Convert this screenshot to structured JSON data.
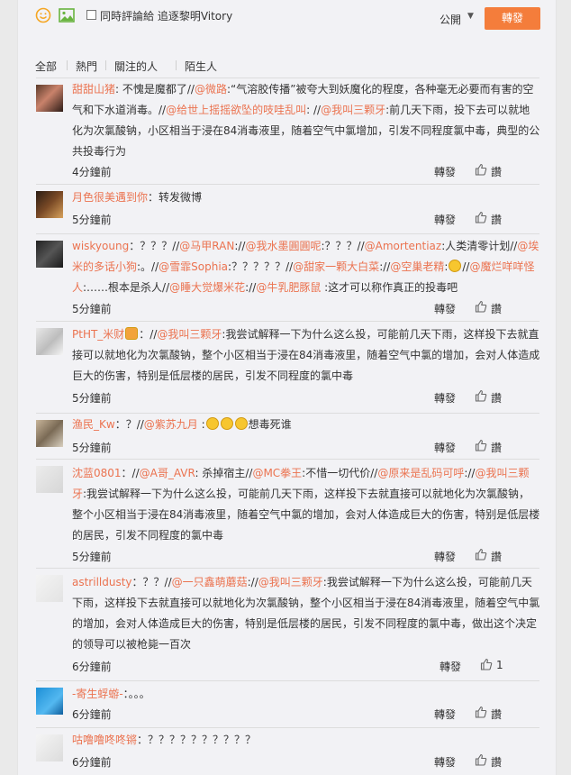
{
  "toolbar": {
    "emoji_icon": "smile-icon",
    "image_icon": "image-icon",
    "checkbox_label": "同時評論給 追逐黎明Vitory",
    "visibility": "公開",
    "forward_button": "轉發"
  },
  "tabs": [
    "全部",
    "熱門",
    "關注的人",
    "陌生人"
  ],
  "actions": {
    "forward": "轉發",
    "like": "讚"
  },
  "comments": [
    {
      "user": "甜甜山猪",
      "segments": [
        ": 不愧是魔都了//",
        "@微路",
        ":“气溶胶传播”被夸大到妖魔化的程度，各种毫无必要而有害的空气和下水道消毒。//",
        "@给世上摇摇欲坠的吱哇乱叫",
        ": //",
        "@我叫三颗牙",
        ":前几天下雨，投下去可以就地化为次氯酸钠，小区相当于浸在84消毒液里，随着空气中氯增加，引发不同程度氯中毒，典型的公共投毒行为"
      ],
      "time": "4分鐘前",
      "likes": ""
    },
    {
      "user": "月色很美遇到你",
      "segments": [
        "：转发微博"
      ],
      "time": "5分鐘前",
      "likes": ""
    },
    {
      "user": "wiskyoung",
      "segments": [
        "：？？？//",
        "@马甲RAN",
        "://",
        "@我水墨圓圓呢",
        ":？？？//",
        "@Amortentiaz",
        ":人类清零计划//",
        "@埃米的多话小狗",
        ":。//",
        "@雪霏Sophia",
        ":？？？？？//",
        "@甜家一颗大白菜",
        "://",
        "@空巢老精",
        ":",
        "[emoji]",
        "//",
        "@魔烂咩咩怪人",
        ":……根本是杀人//",
        "@睡大觉爆米花",
        "://",
        "@牛乳肥豚鼠",
        " :这才可以称作真正的投毒吧"
      ],
      "time": "5分鐘前",
      "likes": ""
    },
    {
      "user": "PtHT_米财",
      "segments": [
        "[badge]",
        "：//",
        "@我叫三颗牙",
        ":我尝试解释一下为什么这么投，可能前几天下雨，这样投下去就直接可以就地化为次氯酸钠，整个小区相当于浸在84消毒液里，随着空气中氯的增加，会对人体造成巨大的伤害，特别是低层楼的居民，引发不同程度的氯中毒"
      ],
      "time": "5分鐘前",
      "likes": ""
    },
    {
      "user": "渔民_Kw",
      "segments": [
        "：？//",
        "@紫苏九月",
        " :",
        "[emoji]",
        "[emoji]",
        "[emoji]",
        "想毒死谁"
      ],
      "time": "5分鐘前",
      "likes": ""
    },
    {
      "user": "沈蓝0801",
      "segments": [
        "：//",
        "@A哥_AVR",
        ": 杀掉宿主//",
        "@MC拳王",
        ":不惜一切代价//",
        "@原来是乱码可呼",
        "://",
        "@我叫三颗牙",
        ":我尝试解释一下为什么这么投，可能前几天下雨，这样投下去就直接可以就地化为次氯酸钠，整个小区相当于浸在84消毒液里，随着空气中氯的增加，会对人体造成巨大的伤害，特别是低层楼的居民，引发不同程度的氯中毒"
      ],
      "time": "5分鐘前",
      "likes": ""
    },
    {
      "user": "astrilldusty",
      "segments": [
        "：？？//",
        "@一只鑫萌蘑菇",
        "://",
        "@我叫三颗牙",
        ":我尝试解释一下为什么这么投，可能前几天下雨，这样投下去就直接可以就地化为次氯酸钠，整个小区相当于浸在84消毒液里，随着空气中氯的增加，会对人体造成巨大的伤害，特别是低层楼的居民，引发不同程度的氯中毒，做出这个决定的领导可以被枪毙一百次"
      ],
      "time": "6分鐘前",
      "likes": "1"
    },
    {
      "user": "-寄生蜉蝣-",
      "segments": [
        "：。。。"
      ],
      "time": "6分鐘前",
      "likes": ""
    },
    {
      "user": "咕噜噜咚咚锵",
      "segments": [
        "：？？？？？？？？？？"
      ],
      "time": "6分鐘前",
      "likes": ""
    }
  ],
  "colors": {
    "accent": "#eb7350",
    "button": "#f47d3b",
    "panel": "#f2f2f5"
  }
}
